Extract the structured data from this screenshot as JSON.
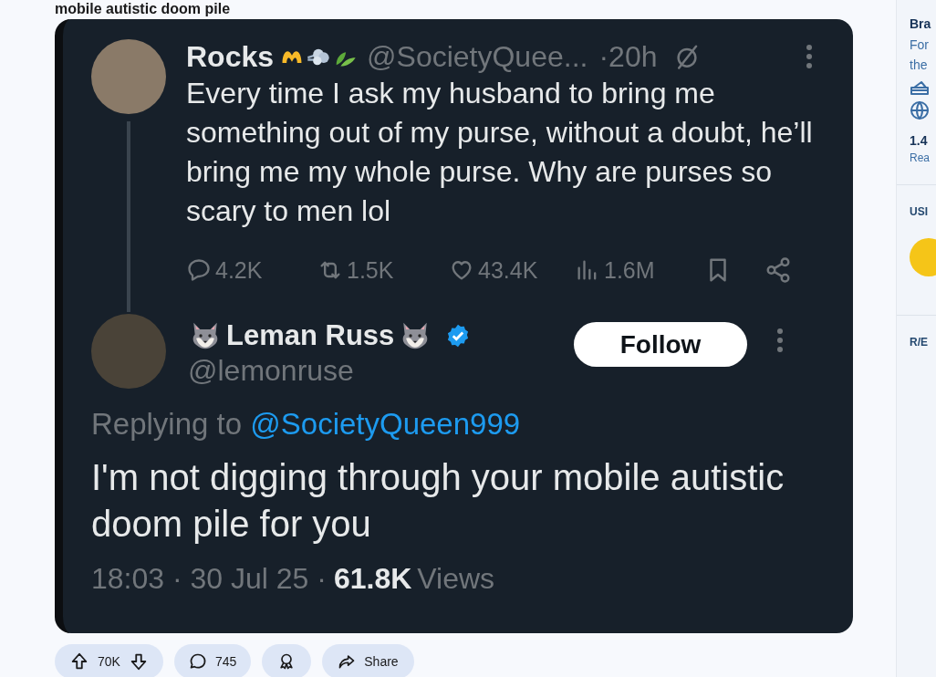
{
  "post": {
    "title": "mobile autistic doom pile"
  },
  "original_tweet": {
    "name": "Rocks",
    "handle": "@SocietyQuee...",
    "time": "·20h",
    "text": "Every time I ask my husband to bring me something out of my purse, without a doubt, he’ll bring me my whole purse. Why are purses so scary to men lol",
    "stats": [
      {
        "kind": "reply",
        "value": "4.2K"
      },
      {
        "kind": "repost",
        "value": "1.5K"
      },
      {
        "kind": "like",
        "value": "43.4K"
      },
      {
        "kind": "views",
        "value": "1.6M"
      }
    ]
  },
  "reply_tweet": {
    "name": "Leman Russ",
    "verified": true,
    "handle": "@lemonruse",
    "follow_label": "Follow",
    "replying_label": "Replying to",
    "replying_to": "@SocietyQueen999",
    "text": "I'm not digging through your mobile autistic doom pile for you",
    "timestamp": "18:03 · 30 Jul 25 ·",
    "views_count": "61.8K",
    "views_label": "Views"
  },
  "actions": {
    "score": "70K",
    "comments": "745",
    "share_label": "Share"
  },
  "sidebar": {
    "title": "Bra",
    "description_lines": [
      "For",
      "the"
    ],
    "stat": "1.4",
    "stat_label": "Rea",
    "section_1": "USI",
    "section_2": "R/E"
  }
}
